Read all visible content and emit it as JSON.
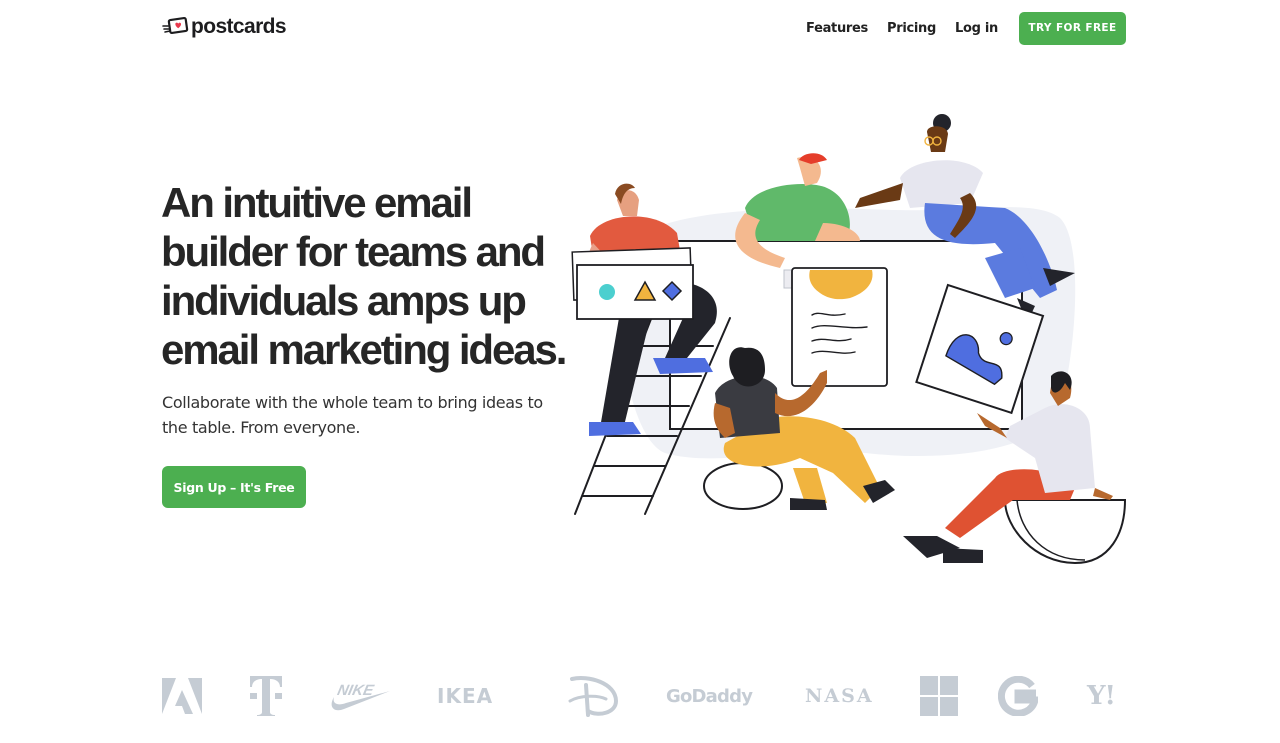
{
  "header": {
    "logo_text": "postcards",
    "logo_icon": "postcard-heart-icon",
    "nav": [
      {
        "label": "Features"
      },
      {
        "label": "Pricing"
      },
      {
        "label": "Log in"
      }
    ],
    "cta_label": "TRY FOR FREE"
  },
  "hero": {
    "title_lines": [
      "An intuitive email",
      "builder for teams and",
      "individuals amps up",
      "email marketing ideas."
    ],
    "subtitle": "Collaborate with the whole team to bring ideas to the table. From everyone.",
    "cta_label": "Sign Up – It's Free",
    "illustration": "team-collaborating-on-email-illustration"
  },
  "brands": [
    {
      "name": "Adobe",
      "icon": "adobe-logo-icon"
    },
    {
      "name": "T-Mobile",
      "icon": "telekom-logo-icon"
    },
    {
      "name": "NIKE",
      "icon": "nike-logo-icon"
    },
    {
      "name": "IKEA",
      "icon": "ikea-logo-icon"
    },
    {
      "name": "Disney",
      "icon": "disney-logo-icon"
    },
    {
      "name": "GoDaddy",
      "icon": "godaddy-logo-icon"
    },
    {
      "name": "NASA",
      "icon": "nasa-logo-icon"
    },
    {
      "name": "Microsoft",
      "icon": "microsoft-logo-icon"
    },
    {
      "name": "Google",
      "icon": "google-logo-icon"
    },
    {
      "name": "Y!",
      "icon": "yahoo-logo-icon"
    }
  ],
  "colors": {
    "brand_green": "#4caf50",
    "heading": "#262626",
    "brand_logos_gray": "#c5ccd4"
  }
}
